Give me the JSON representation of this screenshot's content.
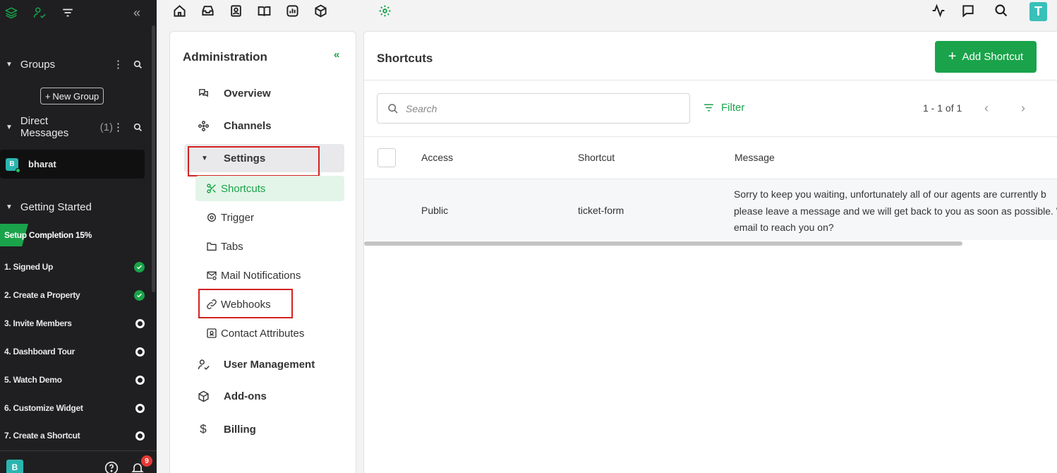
{
  "sidebar": {
    "groups_label": "Groups",
    "new_group_label": "New Group",
    "dm_label": "Direct Messages",
    "dm_count": "(1)",
    "dm_user_initial": "B",
    "dm_user_name": "bharat",
    "getting_started_label": "Getting Started",
    "setup_label": "Setup Completion 15%",
    "setup_progress": 0.15,
    "steps": [
      {
        "label": "1. Signed Up",
        "done": true
      },
      {
        "label": "2. Create a Property",
        "done": true
      },
      {
        "label": "3. Invite Members",
        "done": false
      },
      {
        "label": "4. Dashboard Tour",
        "done": false
      },
      {
        "label": "5. Watch Demo",
        "done": false
      },
      {
        "label": "6. Customize Widget",
        "done": false
      },
      {
        "label": "7. Create a Shortcut",
        "done": false
      }
    ],
    "bottom_avatar": "B",
    "notification_count": "9"
  },
  "topbar": {
    "avatar_initial": "T",
    "icons": [
      "home-icon",
      "inbox-icon",
      "contacts-icon",
      "book-icon",
      "reports-icon",
      "box-icon",
      "settings-icon",
      "activity-icon",
      "chat-icon",
      "search-icon"
    ]
  },
  "admin": {
    "title": "Administration",
    "collapse": "«",
    "nav": {
      "overview": "Overview",
      "channels": "Channels",
      "settings": "Settings",
      "user_management": "User Management",
      "addons": "Add-ons",
      "billing": "Billing"
    },
    "settings_sub": {
      "shortcuts": "Shortcuts",
      "trigger": "Trigger",
      "tabs": "Tabs",
      "mail_notifications": "Mail Notifications",
      "webhooks": "Webhooks",
      "contact_attributes": "Contact Attributes"
    }
  },
  "main": {
    "title": "Shortcuts",
    "add_button": "Add Shortcut",
    "search_placeholder": "Search",
    "filter_label": "Filter",
    "pagination": "1 - 1 of 1",
    "columns": [
      "Access",
      "Shortcut",
      "Message"
    ],
    "rows": [
      {
        "access": "Public",
        "shortcut": "ticket-form",
        "message_lines": [
          "Sorry to keep you waiting, unfortunately all of our agents are currently b",
          "please leave a message and we will get back to you as soon as possible. W",
          "email to reach you on?"
        ]
      }
    ]
  },
  "colors": {
    "accent": "#1aa34a",
    "sidebar_bg": "#1f1f21",
    "highlight_box": "#d32222",
    "avatar": "#2bb5b0"
  }
}
